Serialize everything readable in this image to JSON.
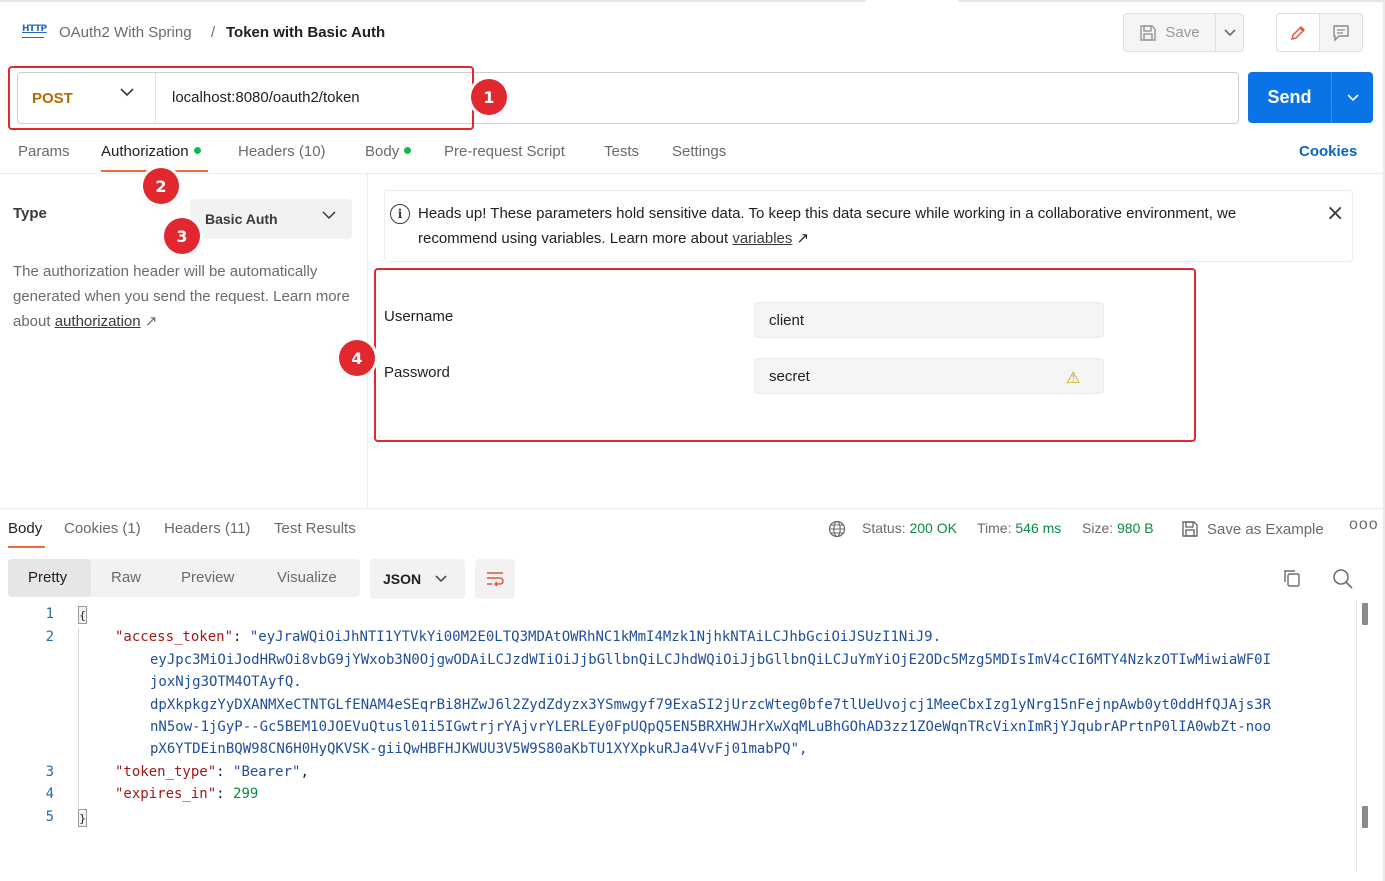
{
  "header": {
    "http_icon_text": "HTTP",
    "collection": "OAuth2 With Spring",
    "separator": "/",
    "request_name": "Token with Basic Auth",
    "save_label": "Save"
  },
  "request": {
    "method": "POST",
    "url": "localhost:8080/oauth2/token",
    "send_label": "Send"
  },
  "annotations": [
    "1",
    "2",
    "3",
    "4"
  ],
  "request_tabs": [
    {
      "label": "Params"
    },
    {
      "label": "Authorization"
    },
    {
      "label": "Headers (10)"
    },
    {
      "label": "Body"
    },
    {
      "label": "Pre-request Script"
    },
    {
      "label": "Tests"
    },
    {
      "label": "Settings"
    }
  ],
  "cookies_label": "Cookies",
  "auth": {
    "type_label": "Type",
    "type_value": "Basic Auth",
    "desc_text": "The authorization header will be automatically generated when you send the request. Learn more about ",
    "desc_link": "authorization",
    "notice_text": "Heads up! These parameters hold sensitive data. To keep this data secure while working in a collaborative environment, we recommend using variables. Learn more about ",
    "notice_link": "variables",
    "username_label": "Username",
    "username_value": "client",
    "password_label": "Password",
    "password_value": "secret"
  },
  "response_tabs": [
    {
      "label": "Body"
    },
    {
      "label": "Cookies (1)"
    },
    {
      "label": "Headers (11)"
    },
    {
      "label": "Test Results"
    }
  ],
  "response_meta": {
    "status_label": "Status:",
    "status_value": "200 OK",
    "time_label": "Time:",
    "time_value": "546 ms",
    "size_label": "Size:",
    "size_value": "980 B",
    "save_example": "Save as Example"
  },
  "view_tabs": [
    "Pretty",
    "Raw",
    "Preview",
    "Visualize"
  ],
  "format": "JSON",
  "code": {
    "line_numbers": [
      "1",
      "2",
      "3",
      "4",
      "5"
    ],
    "open_brace": "{",
    "close_brace": "}",
    "access_token_key": "\"access_token\"",
    "access_token_lines": [
      "\"eyJraWQiOiJhNTI1YTVkYi00M2E0LTQ3MDAtOWRhNC1kMmI4Mzk1NjhkNTAiLCJhbGciOiJSUzI1NiJ9.",
      "eyJpc3MiOiJodHRwOi8vbG9jYWxob3N0OjgwODAiLCJzdWIiOiJjbGllbnQiLCJhdWQiOiJjbGllbnQiLCJuYmYiOjE2ODc5Mzg5MDIsImV4cCI6MTY4NzkzOTIwMiwiaWF0I",
      "joxNjg3OTM4OTAyfQ.",
      "dpXkpkgzYyDXANMXeCTNTGLfENAM4eSEqrBi8HZwJ6l2ZydZdyzx3YSmwgyf79ExaSI2jUrzcWteg0bfe7tlUeUvojcj1MeeCbxIzg1yNrg15nFejnpAwb0yt0ddHfQJAjs3R",
      "nN5ow-1jGyP--Gc5BEM10JOEVuQtusl01i5IGwtrjrYAjvrYLERLEy0FpUQpQ5EN5BRXHWJHrXwXqMLuBhGOhAD3zz1ZOeWqnTRcVixnImRjYJqubrAPrtnP0lIA0wbZt-noo",
      "pX6YTDEinBQW98CN6H0HyQKVSK-giiQwHBFHJKWUU3V5W9S80aKbTU1XYXpkuRJa4VvFj01mabPQ\","
    ],
    "token_type_key": "\"token_type\"",
    "token_type_value": "\"Bearer\"",
    "expires_in_key": "\"expires_in\"",
    "expires_in_value": "299"
  }
}
